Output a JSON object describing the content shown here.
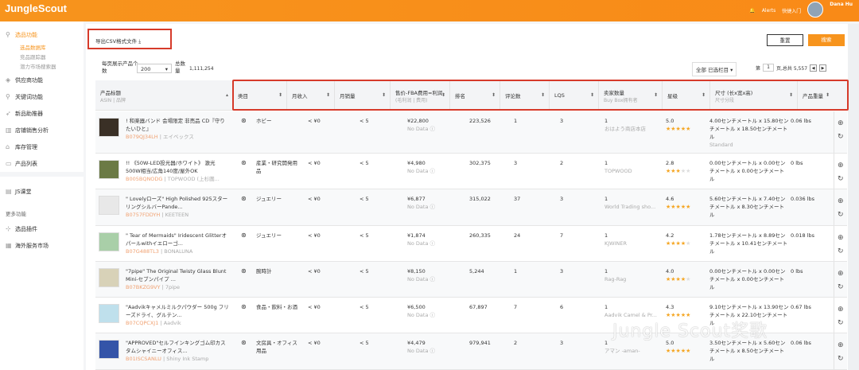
{
  "header": {
    "logo": "JungleScout",
    "alerts": "Alerts",
    "quick": "快捷入门",
    "user": "Dana Hu"
  },
  "sidebar": {
    "section": "选品功能",
    "subs": [
      "选品数据库",
      "竞品跟踪器",
      "潜力市场搜索器"
    ],
    "items": [
      "供应商功能",
      "关键词功能",
      "新品助推器",
      "店铺销售分析",
      "库存管理",
      "产品列表"
    ],
    "js": "JS课堂",
    "more": "更多功能",
    "extra": [
      "选品插件",
      "海外服务市场"
    ]
  },
  "toolbar": {
    "export": "导出CSV格式文件",
    "reset": "重置",
    "search": "搜索",
    "per_page": "每页展示产品个数",
    "per_page_val": "200",
    "total_label": "总数量",
    "total": "1,111,254",
    "columns": "全部 已选栏目",
    "page_prefix": "第",
    "page": "1",
    "page_suffix": "页,总共 5,557"
  },
  "columns": [
    {
      "t": "产品标题",
      "s": "ASIN | 品牌"
    },
    {
      "t": "类目"
    },
    {
      "t": "月收入"
    },
    {
      "t": "月销量"
    },
    {
      "t": "售价-FBA费用=利润",
      "s": "(毛利润 | 费用)"
    },
    {
      "t": "排名"
    },
    {
      "t": "评论数"
    },
    {
      "t": "LQS"
    },
    {
      "t": "卖家数量",
      "s": "Buy Box拥有者"
    },
    {
      "t": "星级"
    },
    {
      "t": "尺寸 (长x宽x高)",
      "s": "尺寸分段"
    },
    {
      "t": "产品重量"
    }
  ],
  "rows": [
    {
      "title": "! 和楽器バンド 会場限定 非売品 CD『守りたいひと』",
      "asin": "B079QJ34LH",
      "brand": "エイベックス",
      "cat": "ホビー",
      "rev": "< ¥0",
      "sales": "< 5",
      "price": "¥22,800",
      "nodata": "No Data",
      "rank": "223,526",
      "reviews": "1",
      "lqs": "3",
      "sellers": "1",
      "owner": "おはよう商店本店",
      "rating": "5.0",
      "stars": 5,
      "size": "4.00センチメートル x 15.80センチメートル x 18.50センチメートル",
      "tier": "Standard",
      "weight": "0.06 lbs",
      "img": "#3a3026"
    },
    {
      "title": "!! 《50W-LED投光器/ホワイト》 激光500W相当/広角140度/屋外OK",
      "asin": "B005BQNODG",
      "brand": "TOPWOOD (上杉圓...",
      "cat": "産業・研究開発用品",
      "rev": "< ¥0",
      "sales": "< 5",
      "price": "¥4,980",
      "nodata": "No Data",
      "rank": "302,375",
      "reviews": "3",
      "lqs": "2",
      "sellers": "1",
      "owner": "TOPWOOD",
      "rating": "2.8",
      "stars": 3,
      "size": "0.00センチメートル x 0.00センチメートル x 0.00センチメートル",
      "tier": "",
      "weight": "0 lbs",
      "img": "#6b7a45"
    },
    {
      "title": "\" Lovelyローズ\" High Polished 925スターリングシルバーPande...",
      "asin": "B0757FDDYH",
      "brand": "KEETEEN",
      "cat": "ジュエリー",
      "rev": "< ¥0",
      "sales": "< 5",
      "price": "¥6,877",
      "nodata": "No Data",
      "rank": "315,022",
      "reviews": "37",
      "lqs": "3",
      "sellers": "1",
      "owner": "World Trading sho...",
      "rating": "4.6",
      "stars": 4.5,
      "size": "5.60センチメートル x 7.40センチメートル x 8.30センチメートル",
      "tier": "",
      "weight": "0.036 lbs",
      "img": "#e8e8e8"
    },
    {
      "title": "\" Tear of Mermaids\" Iridescent Glitterオパールwithイエローゴ...",
      "asin": "B07G488TL3",
      "brand": "BONALUNA",
      "cat": "ジュエリー",
      "rev": "< ¥0",
      "sales": "< 5",
      "price": "¥1,874",
      "nodata": "No Data",
      "rank": "260,335",
      "reviews": "24",
      "lqs": "7",
      "sellers": "1",
      "owner": "KJWINER",
      "rating": "4.2",
      "stars": 4,
      "size": "1.78センチメートル x 8.89センチメートル x 10.41センチメートル",
      "tier": "",
      "weight": "0.018 lbs",
      "img": "#a9cfa8"
    },
    {
      "title": "\"7pipe\" The Original Twisty Glass Blunt Mini-セブンパイプ ...",
      "asin": "B07BKZG9VY",
      "brand": "7pipe",
      "cat": "腕時計",
      "rev": "< ¥0",
      "sales": "< 5",
      "price": "¥8,150",
      "nodata": "No Data",
      "rank": "5,244",
      "reviews": "1",
      "lqs": "3",
      "sellers": "1",
      "owner": "Rag-Rag",
      "rating": "4.0",
      "stars": 4,
      "size": "0.00センチメートル x 0.00センチメートル x 0.00センチメートル",
      "tier": "",
      "weight": "0 lbs",
      "img": "#d8d2b8"
    },
    {
      "title": "\"Aadvikキャメルミルクパウダー 500g フリーズドライ、グルテン...",
      "asin": "B07CQPCXJ1",
      "brand": "Aadvik",
      "cat": "食品・飲料・お酒",
      "rev": "< ¥0",
      "sales": "< 5",
      "price": "¥6,500",
      "nodata": "No Data",
      "rank": "67,897",
      "reviews": "7",
      "lqs": "6",
      "sellers": "1",
      "owner": "Aadvik Camel & Pr...",
      "rating": "4.3",
      "stars": 4.5,
      "size": "9.10センチメートル x 13.90センチメートル x 22.10センチメートル",
      "tier": "",
      "weight": "0.67 lbs",
      "img": "#bfe0ec"
    },
    {
      "title": "\"APPROVED\"セルフインキングゴム印カスタムシャイニーオフィス...",
      "asin": "B01ISCSANLU",
      "brand": "Shiny Ink Stamp",
      "cat": "文房具・オフィス用品",
      "rev": "< ¥0",
      "sales": "< 5",
      "price": "¥4,479",
      "nodata": "No Data",
      "rank": "979,941",
      "reviews": "2",
      "lqs": "3",
      "sellers": "1",
      "owner": "アマン -aman-",
      "rating": "5.0",
      "stars": 5,
      "size": "3.50センチメートル x 5.60センチメートル x 8.50センチメートル",
      "tier": "",
      "weight": "0.06 lbs",
      "img": "#3454a8"
    }
  ],
  "watermark": "Jungle Scout奖歌",
  "colors": {
    "brand": "#f7941d",
    "highlight": "#d63a2a",
    "star": "#f5a623"
  }
}
